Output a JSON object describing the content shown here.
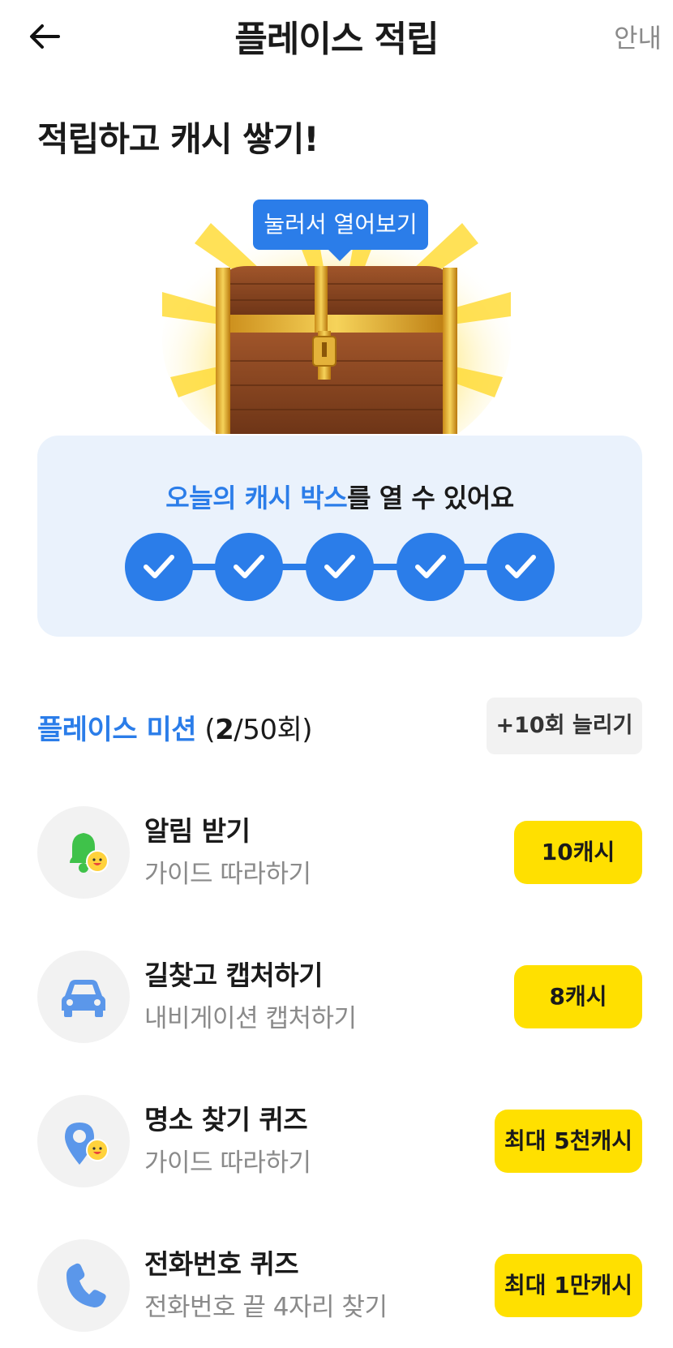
{
  "header": {
    "title": "플레이스 적립",
    "guide_label": "안내"
  },
  "headline": "적립하고 캐시 쌓기!",
  "chest": {
    "tooltip": "눌러서 열어보기"
  },
  "progress": {
    "text_highlight": "오늘의 캐시 박스",
    "text_rest": "를 열 수 있어요",
    "completed_steps": 5,
    "total_steps": 5
  },
  "mission": {
    "title": "플레이스 미션",
    "count_open": "(",
    "count_done": "2",
    "count_rest": "/50회)",
    "more_button": "+10회 늘리기"
  },
  "items": [
    {
      "title": "알림 받기",
      "subtitle": "가이드 따라하기",
      "reward": "10캐시",
      "icon": "bell-icon"
    },
    {
      "title": "길찾고 캡처하기",
      "subtitle": "내비게이션 캡처하기",
      "reward": "8캐시",
      "icon": "car-icon"
    },
    {
      "title": "명소 찾기 퀴즈",
      "subtitle": "가이드 따라하기",
      "reward": "최대 5천캐시",
      "icon": "map-pin-icon"
    },
    {
      "title": "전화번호 퀴즈",
      "subtitle": "전화번호 끝 4자리 찾기",
      "reward": "최대 1만캐시",
      "icon": "phone-icon"
    }
  ],
  "colors": {
    "accent": "#2b7de9",
    "reward_bg": "#ffe000",
    "card_bg": "#eaf2fc",
    "icon_bell": "#3fc24a",
    "icon_blue": "#5b97ea"
  }
}
